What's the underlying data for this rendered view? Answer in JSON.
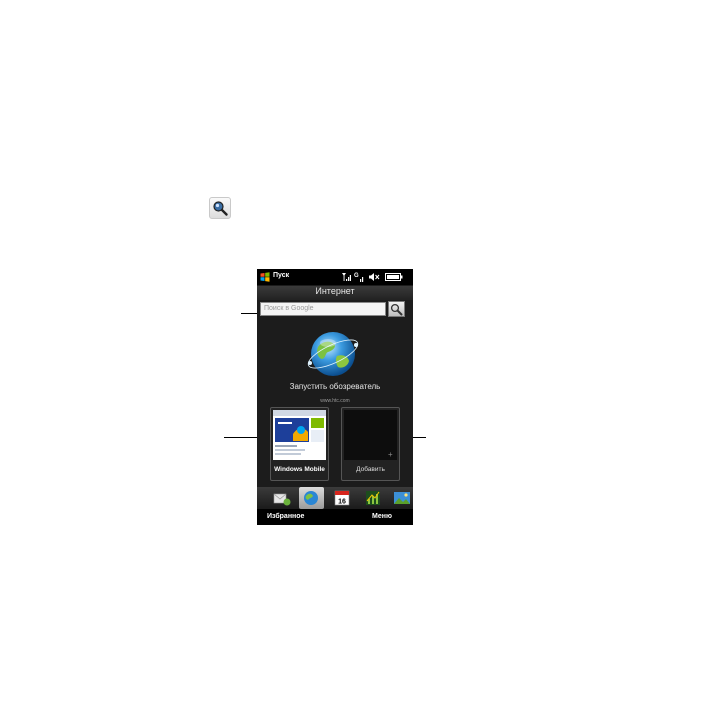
{
  "status_bar": {
    "start_label": "Пуск"
  },
  "internet_tab": {
    "title": "Интернет",
    "search": {
      "placeholder": "Поиск в Google"
    },
    "launch_browser_label": "Запустить обозреватель",
    "home_url": "www.htc.com",
    "favorites": [
      {
        "label": "Windows Mobile"
      },
      {
        "label": "Добавить"
      }
    ]
  },
  "softkeys": {
    "left": "Избранное",
    "right": "Меню"
  },
  "launcher": {
    "calendar_day": "16"
  },
  "colors": {
    "phone_bg": "#1c1c1c",
    "globe_blue": "#1f7fcf",
    "globe_green": "#8cc63f"
  },
  "icons": [
    "magnifier-icon",
    "windows-flag-icon",
    "signal-icon",
    "gprs-icon",
    "volume-muted-icon",
    "battery-icon",
    "globe-icon",
    "mail-icon",
    "calendar-icon",
    "stocks-icon",
    "photos-icon"
  ]
}
